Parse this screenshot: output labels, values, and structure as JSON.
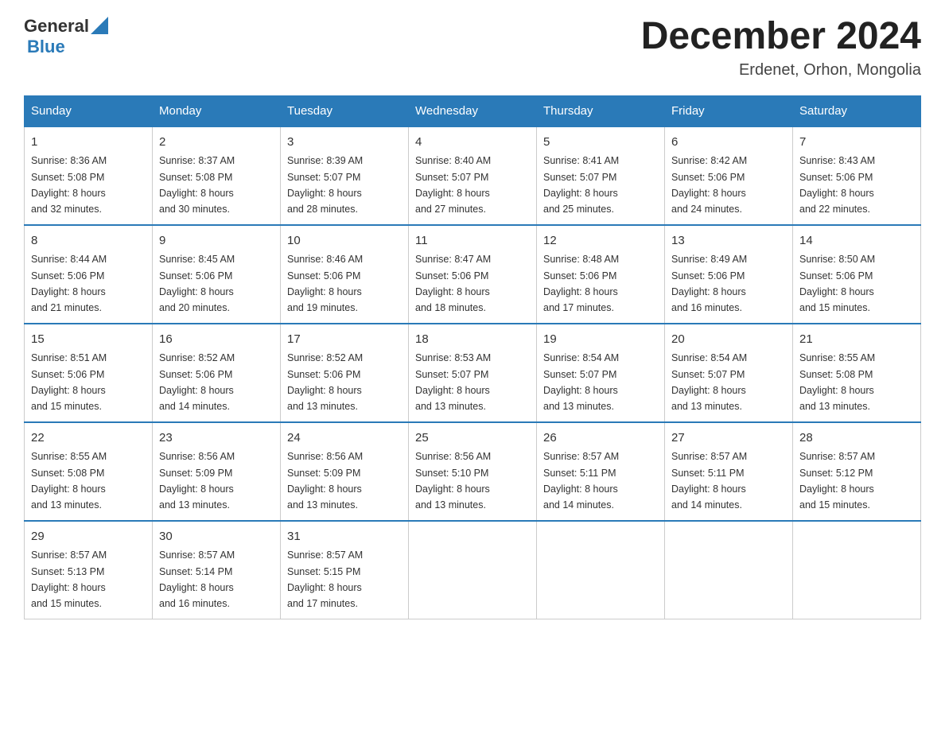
{
  "header": {
    "logo_general": "General",
    "logo_blue": "Blue",
    "month_title": "December 2024",
    "location": "Erdenet, Orhon, Mongolia"
  },
  "days_of_week": [
    "Sunday",
    "Monday",
    "Tuesday",
    "Wednesday",
    "Thursday",
    "Friday",
    "Saturday"
  ],
  "weeks": [
    [
      {
        "day": "1",
        "sunrise": "8:36 AM",
        "sunset": "5:08 PM",
        "daylight_hours": "8 hours",
        "daylight_minutes": "and 32 minutes."
      },
      {
        "day": "2",
        "sunrise": "8:37 AM",
        "sunset": "5:08 PM",
        "daylight_hours": "8 hours",
        "daylight_minutes": "and 30 minutes."
      },
      {
        "day": "3",
        "sunrise": "8:39 AM",
        "sunset": "5:07 PM",
        "daylight_hours": "8 hours",
        "daylight_minutes": "and 28 minutes."
      },
      {
        "day": "4",
        "sunrise": "8:40 AM",
        "sunset": "5:07 PM",
        "daylight_hours": "8 hours",
        "daylight_minutes": "and 27 minutes."
      },
      {
        "day": "5",
        "sunrise": "8:41 AM",
        "sunset": "5:07 PM",
        "daylight_hours": "8 hours",
        "daylight_minutes": "and 25 minutes."
      },
      {
        "day": "6",
        "sunrise": "8:42 AM",
        "sunset": "5:06 PM",
        "daylight_hours": "8 hours",
        "daylight_minutes": "and 24 minutes."
      },
      {
        "day": "7",
        "sunrise": "8:43 AM",
        "sunset": "5:06 PM",
        "daylight_hours": "8 hours",
        "daylight_minutes": "and 22 minutes."
      }
    ],
    [
      {
        "day": "8",
        "sunrise": "8:44 AM",
        "sunset": "5:06 PM",
        "daylight_hours": "8 hours",
        "daylight_minutes": "and 21 minutes."
      },
      {
        "day": "9",
        "sunrise": "8:45 AM",
        "sunset": "5:06 PM",
        "daylight_hours": "8 hours",
        "daylight_minutes": "and 20 minutes."
      },
      {
        "day": "10",
        "sunrise": "8:46 AM",
        "sunset": "5:06 PM",
        "daylight_hours": "8 hours",
        "daylight_minutes": "and 19 minutes."
      },
      {
        "day": "11",
        "sunrise": "8:47 AM",
        "sunset": "5:06 PM",
        "daylight_hours": "8 hours",
        "daylight_minutes": "and 18 minutes."
      },
      {
        "day": "12",
        "sunrise": "8:48 AM",
        "sunset": "5:06 PM",
        "daylight_hours": "8 hours",
        "daylight_minutes": "and 17 minutes."
      },
      {
        "day": "13",
        "sunrise": "8:49 AM",
        "sunset": "5:06 PM",
        "daylight_hours": "8 hours",
        "daylight_minutes": "and 16 minutes."
      },
      {
        "day": "14",
        "sunrise": "8:50 AM",
        "sunset": "5:06 PM",
        "daylight_hours": "8 hours",
        "daylight_minutes": "and 15 minutes."
      }
    ],
    [
      {
        "day": "15",
        "sunrise": "8:51 AM",
        "sunset": "5:06 PM",
        "daylight_hours": "8 hours",
        "daylight_minutes": "and 15 minutes."
      },
      {
        "day": "16",
        "sunrise": "8:52 AM",
        "sunset": "5:06 PM",
        "daylight_hours": "8 hours",
        "daylight_minutes": "and 14 minutes."
      },
      {
        "day": "17",
        "sunrise": "8:52 AM",
        "sunset": "5:06 PM",
        "daylight_hours": "8 hours",
        "daylight_minutes": "and 13 minutes."
      },
      {
        "day": "18",
        "sunrise": "8:53 AM",
        "sunset": "5:07 PM",
        "daylight_hours": "8 hours",
        "daylight_minutes": "and 13 minutes."
      },
      {
        "day": "19",
        "sunrise": "8:54 AM",
        "sunset": "5:07 PM",
        "daylight_hours": "8 hours",
        "daylight_minutes": "and 13 minutes."
      },
      {
        "day": "20",
        "sunrise": "8:54 AM",
        "sunset": "5:07 PM",
        "daylight_hours": "8 hours",
        "daylight_minutes": "and 13 minutes."
      },
      {
        "day": "21",
        "sunrise": "8:55 AM",
        "sunset": "5:08 PM",
        "daylight_hours": "8 hours",
        "daylight_minutes": "and 13 minutes."
      }
    ],
    [
      {
        "day": "22",
        "sunrise": "8:55 AM",
        "sunset": "5:08 PM",
        "daylight_hours": "8 hours",
        "daylight_minutes": "and 13 minutes."
      },
      {
        "day": "23",
        "sunrise": "8:56 AM",
        "sunset": "5:09 PM",
        "daylight_hours": "8 hours",
        "daylight_minutes": "and 13 minutes."
      },
      {
        "day": "24",
        "sunrise": "8:56 AM",
        "sunset": "5:09 PM",
        "daylight_hours": "8 hours",
        "daylight_minutes": "and 13 minutes."
      },
      {
        "day": "25",
        "sunrise": "8:56 AM",
        "sunset": "5:10 PM",
        "daylight_hours": "8 hours",
        "daylight_minutes": "and 13 minutes."
      },
      {
        "day": "26",
        "sunrise": "8:57 AM",
        "sunset": "5:11 PM",
        "daylight_hours": "8 hours",
        "daylight_minutes": "and 14 minutes."
      },
      {
        "day": "27",
        "sunrise": "8:57 AM",
        "sunset": "5:11 PM",
        "daylight_hours": "8 hours",
        "daylight_minutes": "and 14 minutes."
      },
      {
        "day": "28",
        "sunrise": "8:57 AM",
        "sunset": "5:12 PM",
        "daylight_hours": "8 hours",
        "daylight_minutes": "and 15 minutes."
      }
    ],
    [
      {
        "day": "29",
        "sunrise": "8:57 AM",
        "sunset": "5:13 PM",
        "daylight_hours": "8 hours",
        "daylight_minutes": "and 15 minutes."
      },
      {
        "day": "30",
        "sunrise": "8:57 AM",
        "sunset": "5:14 PM",
        "daylight_hours": "8 hours",
        "daylight_minutes": "and 16 minutes."
      },
      {
        "day": "31",
        "sunrise": "8:57 AM",
        "sunset": "5:15 PM",
        "daylight_hours": "8 hours",
        "daylight_minutes": "and 17 minutes."
      },
      null,
      null,
      null,
      null
    ]
  ],
  "labels": {
    "sunrise": "Sunrise:",
    "sunset": "Sunset:",
    "daylight": "Daylight:"
  }
}
